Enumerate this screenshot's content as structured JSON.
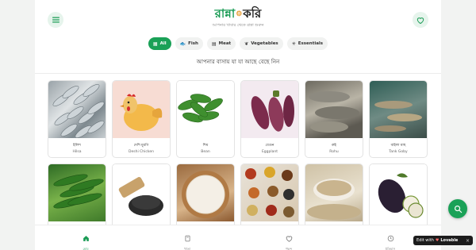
{
  "header": {
    "logo_part1": "রান্না",
    "logo_separator": "⚙",
    "logo_part2": "করি",
    "tagline": "আপনার খাবার থেকে রান্না শুরুন"
  },
  "icons": {
    "menu": "hamburger-icon",
    "favorite": "heart-icon"
  },
  "chips": [
    {
      "label": "All",
      "icon": "grid-icon",
      "glyph": "▦",
      "active": true
    },
    {
      "label": "Fish",
      "icon": "fish-icon",
      "glyph": "🐟",
      "active": false
    },
    {
      "label": "Meat",
      "icon": "meat-icon",
      "glyph": "▤",
      "active": false
    },
    {
      "label": "Vegetables",
      "icon": "leaf-icon",
      "glyph": "❦",
      "active": false
    },
    {
      "label": "Essentials",
      "icon": "sparkle-icon",
      "glyph": "✳",
      "active": false
    }
  ],
  "section_title": "আপনার বাসায় যা যা আছে বেছে নিন",
  "items": [
    {
      "bn": "ইলিশ",
      "en": "Hilsa",
      "img": "hilsa"
    },
    {
      "bn": "দেশি মুরগি",
      "en": "Deshi Chicken",
      "img": "chicken"
    },
    {
      "bn": "শিম",
      "en": "Bean",
      "img": "bean"
    },
    {
      "bn": "বেগুন",
      "en": "Eggplant",
      "img": "eggplant"
    },
    {
      "bn": "রুই",
      "en": "Rohu",
      "img": "rohu"
    },
    {
      "bn": "বাইলা মাছ",
      "en": "Tank Goby",
      "img": "tank"
    },
    {
      "bn": "",
      "en": "",
      "img": "okra"
    },
    {
      "bn": "",
      "en": "",
      "img": "seeds"
    },
    {
      "bn": "",
      "en": "",
      "img": "rice"
    },
    {
      "bn": "",
      "en": "",
      "img": "spice"
    },
    {
      "bn": "",
      "en": "",
      "img": "lentil"
    },
    {
      "bn": "",
      "en": "",
      "img": "brinjal"
    }
  ],
  "bottom_nav": [
    {
      "label": "হোম",
      "icon": "home-icon",
      "active": true
    },
    {
      "label": "খাতা",
      "icon": "book-icon",
      "active": false
    },
    {
      "label": "পছন্দ",
      "icon": "heart-icon",
      "active": false
    },
    {
      "label": "ইতিহাস",
      "icon": "history-icon",
      "active": false
    }
  ],
  "fab": {
    "icon": "search-icon"
  },
  "badge": {
    "text": "Edit with",
    "brand_glyph": "♥",
    "brand": "Lovable",
    "close": "×"
  },
  "colors": {
    "accent": "#1aa157",
    "chip_bg": "#f1f2f1",
    "page_bg": "#f2f3f2"
  }
}
